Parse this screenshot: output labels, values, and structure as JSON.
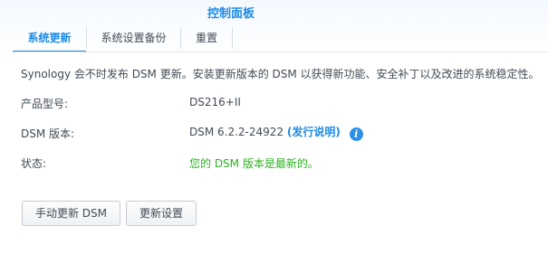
{
  "app_title": "控制面板",
  "tabs": [
    {
      "label": "系统更新",
      "active": true
    },
    {
      "label": "系统设置备份",
      "active": false
    },
    {
      "label": "重置",
      "active": false
    }
  ],
  "description": "Synology 会不时发布 DSM 更新。安装更新版本的 DSM 以获得新功能、安全补丁以及改进的系统稳定性。",
  "info": {
    "model_label": "产品型号:",
    "model_value": "DS216+II",
    "version_label": "DSM 版本:",
    "version_value": "DSM 6.2.2-24922",
    "release_open": "(",
    "release_notes_link": "发行说明",
    "release_close": ")",
    "status_label": "状态:",
    "status_value": "您的 DSM 版本是最新的。"
  },
  "buttons": {
    "manual_update": "手动更新 DSM",
    "update_settings": "更新设置"
  },
  "icons": {
    "info": "info-icon"
  },
  "colors": {
    "accent": "#1e8be6",
    "status_ok": "#2bb11f",
    "text": "#414b55"
  }
}
